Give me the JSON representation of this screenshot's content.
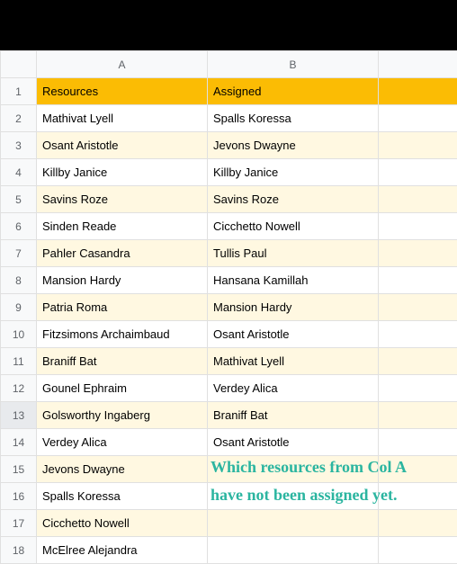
{
  "columns": {
    "A": "A",
    "B": "B"
  },
  "header": {
    "resources": "Resources",
    "assigned": "Assigned"
  },
  "rows": [
    {
      "n": "1",
      "a": "Resources",
      "b": "Assigned",
      "hdr": true
    },
    {
      "n": "2",
      "a": "Mathivat Lyell",
      "b": "Spalls Koressa"
    },
    {
      "n": "3",
      "a": "Osant Aristotle",
      "b": "Jevons Dwayne",
      "alt": true
    },
    {
      "n": "4",
      "a": "Killby Janice",
      "b": "Killby Janice"
    },
    {
      "n": "5",
      "a": "Savins Roze",
      "b": "Savins Roze",
      "alt": true
    },
    {
      "n": "6",
      "a": "Sinden Reade",
      "b": "Cicchetto Nowell"
    },
    {
      "n": "7",
      "a": "Pahler Casandra",
      "b": "Tullis Paul",
      "alt": true
    },
    {
      "n": "8",
      "a": "Mansion Hardy",
      "b": "Hansana Kamillah"
    },
    {
      "n": "9",
      "a": "Patria Roma",
      "b": "Mansion Hardy",
      "alt": true
    },
    {
      "n": "10",
      "a": "Fitzsimons Archaimbaud",
      "b": "Osant Aristotle"
    },
    {
      "n": "11",
      "a": "Braniff Bat",
      "b": "Mathivat Lyell",
      "alt": true
    },
    {
      "n": "12",
      "a": "Gounel Ephraim",
      "b": "Verdey Alica"
    },
    {
      "n": "13",
      "a": "Golsworthy Ingaberg",
      "b": "Braniff Bat",
      "alt": true,
      "sel": true
    },
    {
      "n": "14",
      "a": "Verdey Alica",
      "b": "Osant Aristotle"
    },
    {
      "n": "15",
      "a": "Jevons Dwayne",
      "b": "",
      "alt": true
    },
    {
      "n": "16",
      "a": "Spalls Koressa",
      "b": ""
    },
    {
      "n": "17",
      "a": "Cicchetto Nowell",
      "b": "",
      "alt": true
    },
    {
      "n": "18",
      "a": "McElree Alejandra",
      "b": ""
    }
  ],
  "annotation": {
    "line1": "Which resources from Col A",
    "line2": "have not been assigned yet."
  }
}
